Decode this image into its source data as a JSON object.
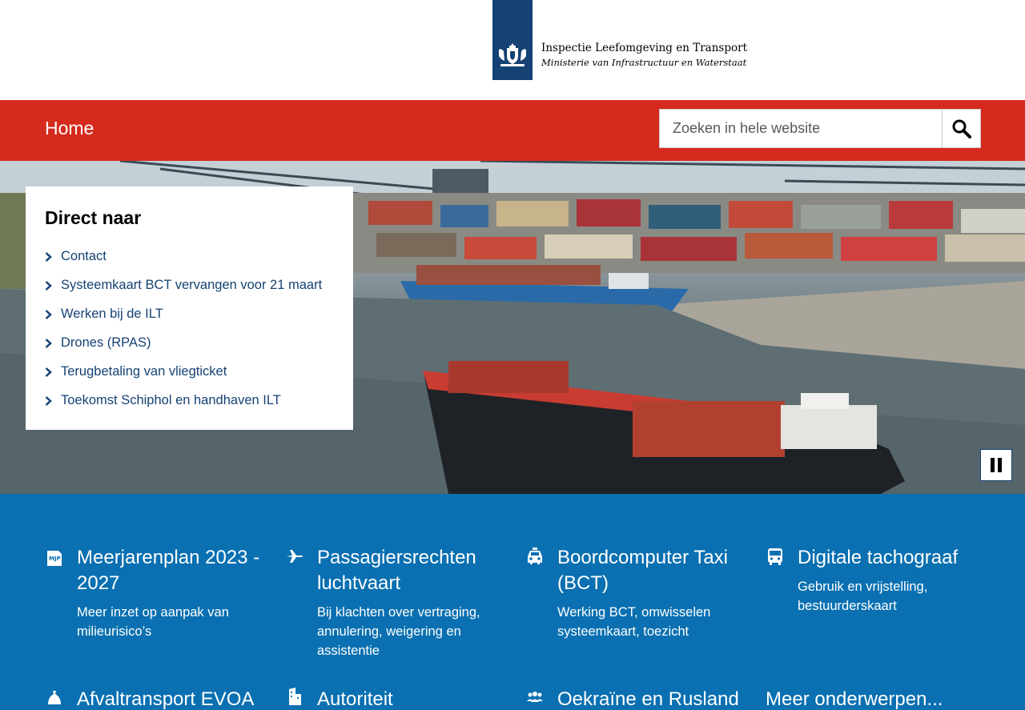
{
  "header": {
    "org_name": "Inspectie Leefomgeving en Transport",
    "ministry": "Ministerie van Infrastructuur en Waterstaat",
    "logo_icon": "rijkswapen-icon"
  },
  "nav": {
    "home_label": "Home"
  },
  "search": {
    "placeholder": "Zoeken in hele website",
    "button_icon": "search-icon"
  },
  "hero": {
    "pause_icon": "pause-icon"
  },
  "direct": {
    "title": "Direct naar",
    "items": [
      {
        "label": "Contact"
      },
      {
        "label": "Systeemkaart BCT vervangen voor 21 maart"
      },
      {
        "label": "Werken bij de ILT"
      },
      {
        "label": "Drones (RPAS)"
      },
      {
        "label": "Terugbetaling van vliegticket"
      },
      {
        "label": "Toekomst Schiphol en handhaven ILT"
      }
    ]
  },
  "topics": [
    {
      "title": "Meerjarenplan 2023 - 2027",
      "desc": "Meer inzet op aanpak van milieurisico’s",
      "icon": "mjp-icon"
    },
    {
      "title": "Passagiersrechten luchtvaart",
      "desc": "Bij klachten over vertraging, annulering, weigering en assistentie",
      "icon": "airplane-icon"
    },
    {
      "title": "Boordcomputer Taxi (BCT)",
      "desc": "Werking BCT, omwisselen systeemkaart, toezicht",
      "icon": "taxi-icon"
    },
    {
      "title": "Digitale tachograaf",
      "desc": "Gebruik en vrijstelling, bestuurderskaart",
      "icon": "bus-icon"
    },
    {
      "title": "Afvaltransport EVOA",
      "desc": "",
      "icon": "waste-bag-icon"
    },
    {
      "title": "Autoriteit",
      "desc": "",
      "icon": "building-icon"
    },
    {
      "title": "Oekraïne en Rusland",
      "desc": "",
      "icon": "people-icon"
    },
    {
      "title": "Meer onderwerpen...",
      "desc": "",
      "icon": ""
    }
  ],
  "colors": {
    "brand_blue": "#154273",
    "nav_red": "#d52b1e",
    "topics_blue": "#0a70b1"
  }
}
